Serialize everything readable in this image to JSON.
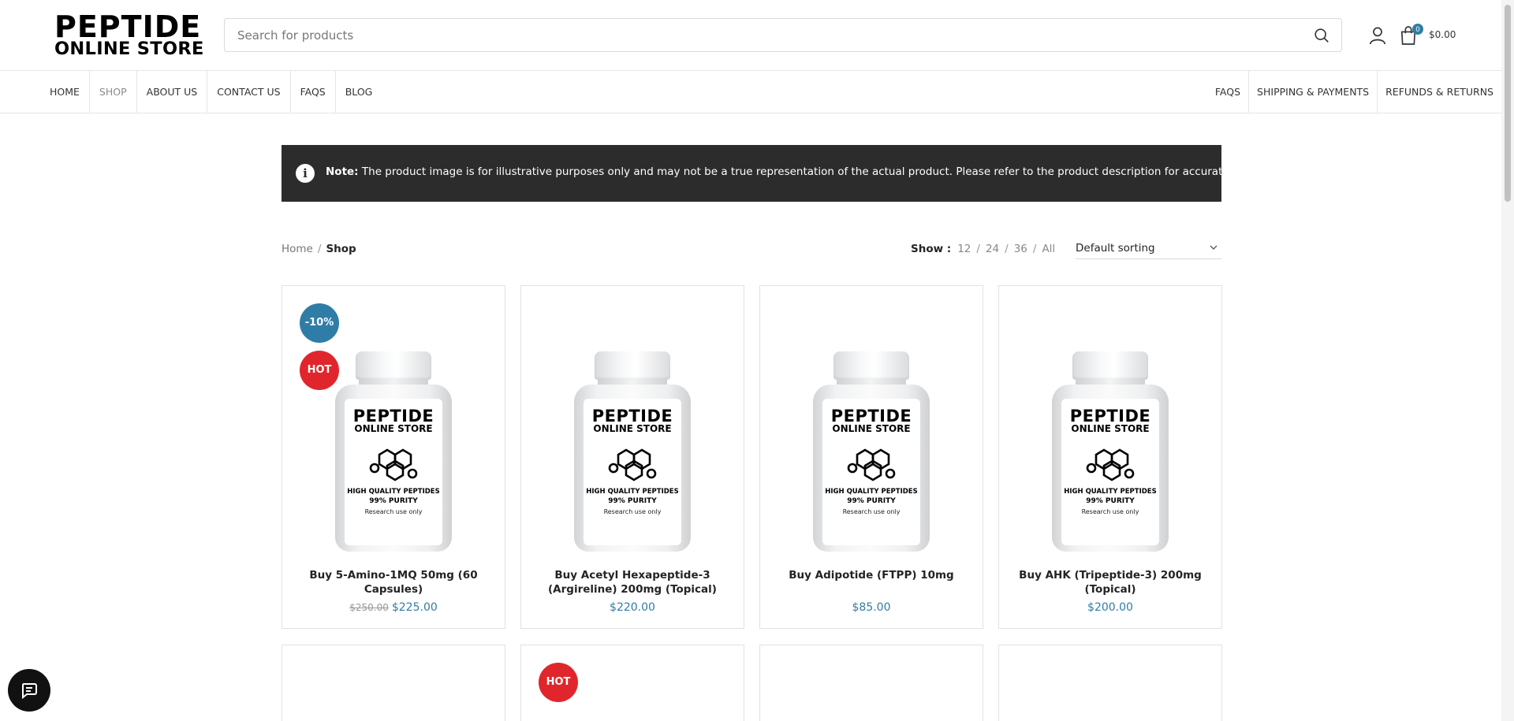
{
  "header": {
    "logo_line1": "PEPTIDE",
    "logo_line2": "ONLINE STORE",
    "search_placeholder": "Search for products",
    "cart_count": "0",
    "cart_total": "$0.00"
  },
  "nav": {
    "left": [
      "HOME",
      "SHOP",
      "ABOUT US",
      "CONTACT US",
      "FAQS",
      "BLOG"
    ],
    "right": [
      "FAQS",
      "SHIPPING & PAYMENTS",
      "REFUNDS & RETURNS"
    ],
    "active": "SHOP"
  },
  "note": {
    "label": "Note:",
    "text": "The product image is for illustrative purposes only and may not be a true representation of the actual product. Please refer to the product description for accurate details."
  },
  "breadcrumb": {
    "home": "Home",
    "sep": "/",
    "current": "Shop"
  },
  "show": {
    "label": "Show :",
    "options": [
      "12",
      "24",
      "36",
      "All"
    ],
    "sep": "/"
  },
  "sort": {
    "value": "Default sorting"
  },
  "bottle_label": {
    "brand1": "PEPTIDE",
    "brand2": "ONLINE STORE",
    "line1": "HIGH QUALITY PEPTIDES",
    "line2": "99% PURITY",
    "line3": "Research use only"
  },
  "products": [
    {
      "title": "Buy 5-Amino-1MQ 50mg (60 Capsules)",
      "old_price": "$250.00",
      "price": "$225.00",
      "badges": [
        "-10%",
        "HOT"
      ]
    },
    {
      "title": "Buy Acetyl Hexapeptide-3 (Argireline) 200mg (Topical)",
      "old_price": "",
      "price": "$220.00",
      "badges": []
    },
    {
      "title": "Buy Adipotide (FTPP) 10mg",
      "old_price": "",
      "price": "$85.00",
      "badges": []
    },
    {
      "title": "Buy AHK (Tripeptide-3) 200mg (Topical)",
      "old_price": "",
      "price": "$200.00",
      "badges": []
    }
  ],
  "row2_badges": [
    "",
    "HOT",
    "",
    ""
  ],
  "colors": {
    "accent": "#2f7da7",
    "hot": "#e0262c",
    "note_bg": "#2c2c2c"
  }
}
